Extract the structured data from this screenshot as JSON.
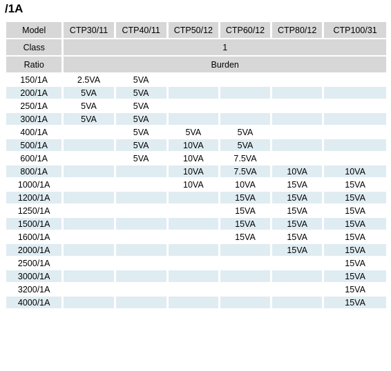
{
  "page": {
    "title": "/1A"
  },
  "table": {
    "header_rows": [
      {
        "label": "Model",
        "cells": [
          "CTP30/11",
          "CTP40/11",
          "CTP50/12",
          "CTP60/12",
          "CTP80/12",
          "CTP100/31"
        ]
      },
      {
        "label": "Class",
        "merged_value": "1"
      },
      {
        "label": "Ratio",
        "merged_value": "Burden"
      }
    ],
    "columns": [
      "Model",
      "CTP30/11",
      "CTP40/11",
      "CTP50/12",
      "CTP60/12",
      "CTP80/12",
      "CTP100/31"
    ],
    "rows": [
      {
        "ratio": "150/1A",
        "values": [
          "2.5VA",
          "5VA",
          "",
          "",
          "",
          ""
        ]
      },
      {
        "ratio": "200/1A",
        "values": [
          "5VA",
          "5VA",
          "",
          "",
          "",
          ""
        ]
      },
      {
        "ratio": "250/1A",
        "values": [
          "5VA",
          "5VA",
          "",
          "",
          "",
          ""
        ]
      },
      {
        "ratio": "300/1A",
        "values": [
          "5VA",
          "5VA",
          "",
          "",
          "",
          ""
        ]
      },
      {
        "ratio": "400/1A",
        "values": [
          "",
          "5VA",
          "5VA",
          "5VA",
          "",
          ""
        ]
      },
      {
        "ratio": "500/1A",
        "values": [
          "",
          "5VA",
          "10VA",
          "5VA",
          "",
          ""
        ]
      },
      {
        "ratio": "600/1A",
        "values": [
          "",
          "5VA",
          "10VA",
          "7.5VA",
          "",
          ""
        ]
      },
      {
        "ratio": "800/1A",
        "values": [
          "",
          "",
          "10VA",
          "7.5VA",
          "10VA",
          "10VA"
        ]
      },
      {
        "ratio": "1000/1A",
        "values": [
          "",
          "",
          "10VA",
          "10VA",
          "15VA",
          "15VA"
        ]
      },
      {
        "ratio": "1200/1A",
        "values": [
          "",
          "",
          "",
          "15VA",
          "15VA",
          "15VA"
        ]
      },
      {
        "ratio": "1250/1A",
        "values": [
          "",
          "",
          "",
          "15VA",
          "15VA",
          "15VA"
        ]
      },
      {
        "ratio": "1500/1A",
        "values": [
          "",
          "",
          "",
          "15VA",
          "15VA",
          "15VA"
        ]
      },
      {
        "ratio": "1600/1A",
        "values": [
          "",
          "",
          "",
          "15VA",
          "15VA",
          "15VA"
        ]
      },
      {
        "ratio": "2000/1A",
        "values": [
          "",
          "",
          "",
          "",
          "15VA",
          "15VA"
        ]
      },
      {
        "ratio": "2500/1A",
        "values": [
          "",
          "",
          "",
          "",
          "",
          "15VA"
        ]
      },
      {
        "ratio": "3000/1A",
        "values": [
          "",
          "",
          "",
          "",
          "",
          "15VA"
        ]
      },
      {
        "ratio": "3200/1A",
        "values": [
          "",
          "",
          "",
          "",
          "",
          "15VA"
        ]
      },
      {
        "ratio": "4000/1A",
        "values": [
          "",
          "",
          "",
          "",
          "",
          "15VA"
        ]
      }
    ]
  },
  "colors": {
    "header_bg": "#d7d7d7",
    "row_alt_bg": "#dfecf2",
    "row_bg": "#ffffff",
    "text": "#000000"
  }
}
